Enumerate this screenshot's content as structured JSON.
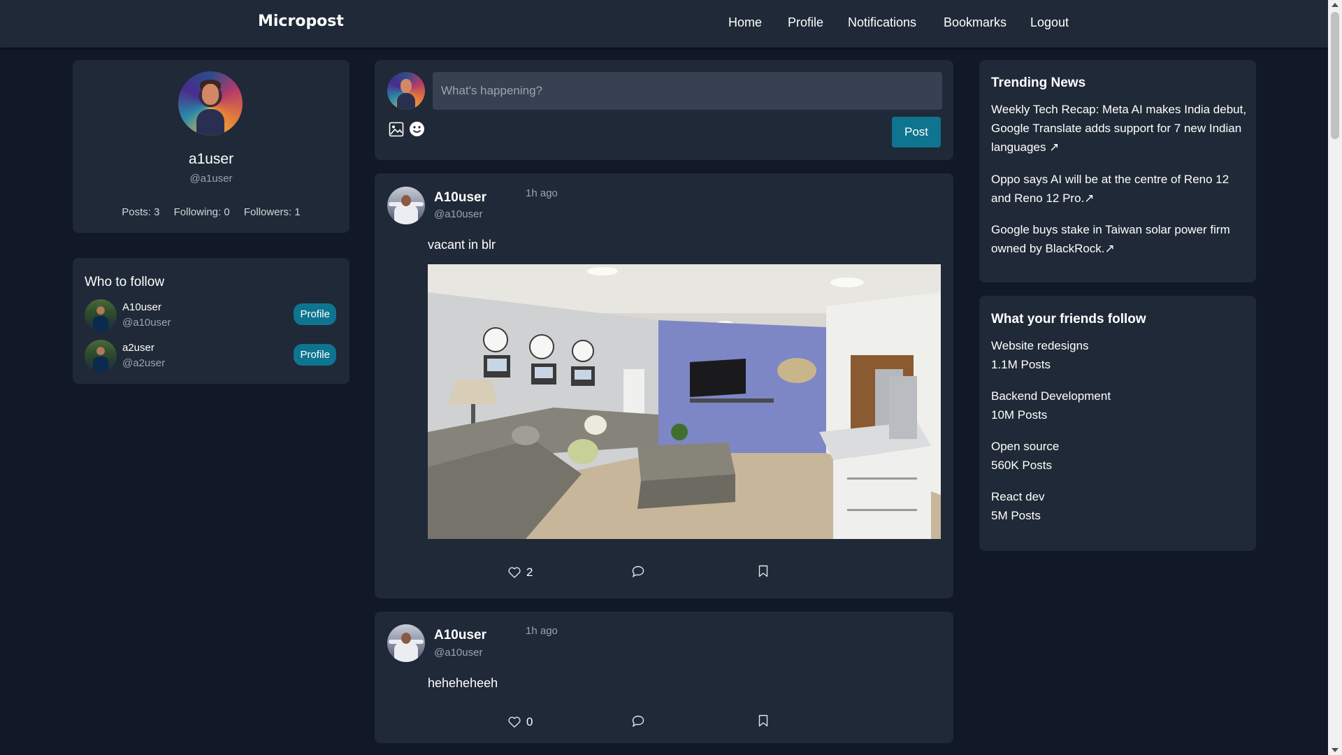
{
  "app": {
    "brand": "Micropost"
  },
  "nav": {
    "links": [
      "Home",
      "Profile",
      "Notifications",
      "Bookmarks",
      "Logout"
    ]
  },
  "profile_card": {
    "name": "a1user",
    "handle": "@a1user",
    "posts": "Posts: 3",
    "following": "Following: 0",
    "followers": "Followers: 1"
  },
  "who_to_follow": {
    "title": "Who to follow",
    "users": [
      {
        "name": "A10user",
        "handle": "@a10user",
        "button": "Profile"
      },
      {
        "name": "a2user",
        "handle": "@a2user",
        "button": "Profile"
      }
    ]
  },
  "composer": {
    "placeholder": "What's happening?",
    "post_label": "Post",
    "icons": [
      "image-icon",
      "emoji-icon"
    ]
  },
  "posts": [
    {
      "author": "A10user",
      "handle": "@a10user",
      "time": "1h ago",
      "text": "vacant in blr",
      "has_image": true,
      "likes": "2"
    },
    {
      "author": "A10user",
      "handle": "@a10user",
      "time": "1h ago",
      "text": "heheheheeh",
      "has_image": false,
      "likes": "0"
    }
  ],
  "trending": {
    "title": "Trending News",
    "items": [
      "Weekly Tech Recap: Meta AI makes India debut, Google Translate adds support for 7 new Indian languages ↗",
      "Oppo says AI will be at the centre of Reno 12 and Reno 12 Pro.↗",
      "Google buys stake in Taiwan solar power firm owned by BlackRock.↗"
    ]
  },
  "friends_follow": {
    "title": "What your friends follow",
    "items": [
      {
        "topic": "Website redesigns",
        "count": "1.1M Posts"
      },
      {
        "topic": "Backend Development",
        "count": "10M Posts"
      },
      {
        "topic": "Open source",
        "count": "560K Posts"
      },
      {
        "topic": "React dev",
        "count": "5M Posts"
      }
    ]
  },
  "colors": {
    "background": "#111827",
    "card": "#1f2937",
    "input": "#374151",
    "accent": "#0e7490",
    "muted_text": "#9ca3af"
  }
}
